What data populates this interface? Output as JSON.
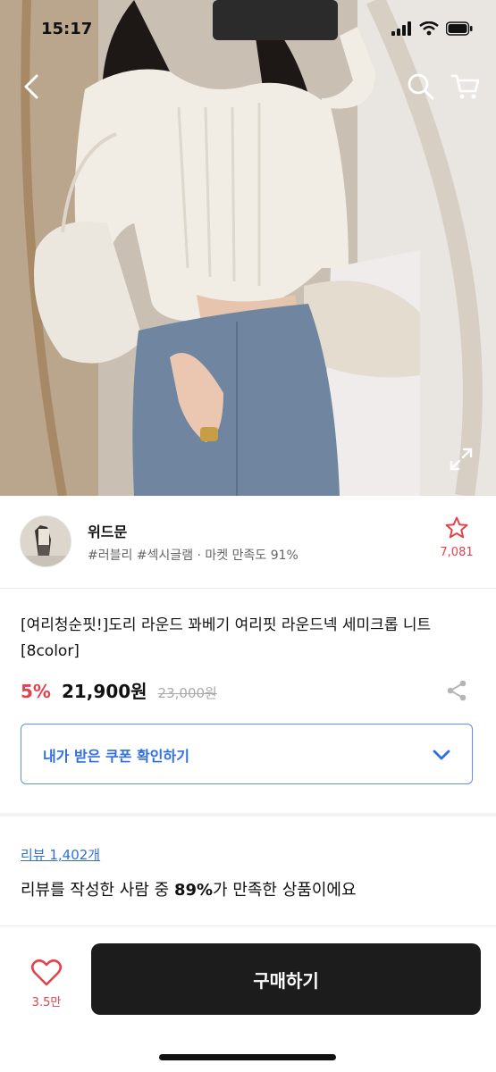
{
  "status_bar": {
    "time": "15:17"
  },
  "header": {
    "back_icon": "chevron-left-icon",
    "search_icon": "search-icon",
    "cart_icon": "cart-icon",
    "expand_icon": "expand-icon"
  },
  "seller": {
    "name": "위드문",
    "meta": "#러블리 #섹시글램 · 마켓 만족도 91%",
    "favorite_count": "7,081"
  },
  "product": {
    "title": "[여리청순핏!]도리 라운드 꽈베기 여리핏 라운드넥 세미크롭 니트[8color]",
    "discount": "5%",
    "sale_price": "21,900원",
    "original_price": "23,000원"
  },
  "coupon": {
    "label": "내가 받은 쿠폰 확인하기"
  },
  "review": {
    "count_label": "리뷰 1,402개",
    "summary_prefix": "리뷰를 작성한 사람 중 ",
    "summary_percent": "89%",
    "summary_suffix": "가 만족한 상품이에요"
  },
  "bottom_bar": {
    "like_count": "3.5만",
    "buy_label": "구매하기"
  },
  "colors": {
    "accent_red": "#e2434c",
    "link_blue": "#2f6fe0",
    "buy_button": "#1c1c1c"
  }
}
